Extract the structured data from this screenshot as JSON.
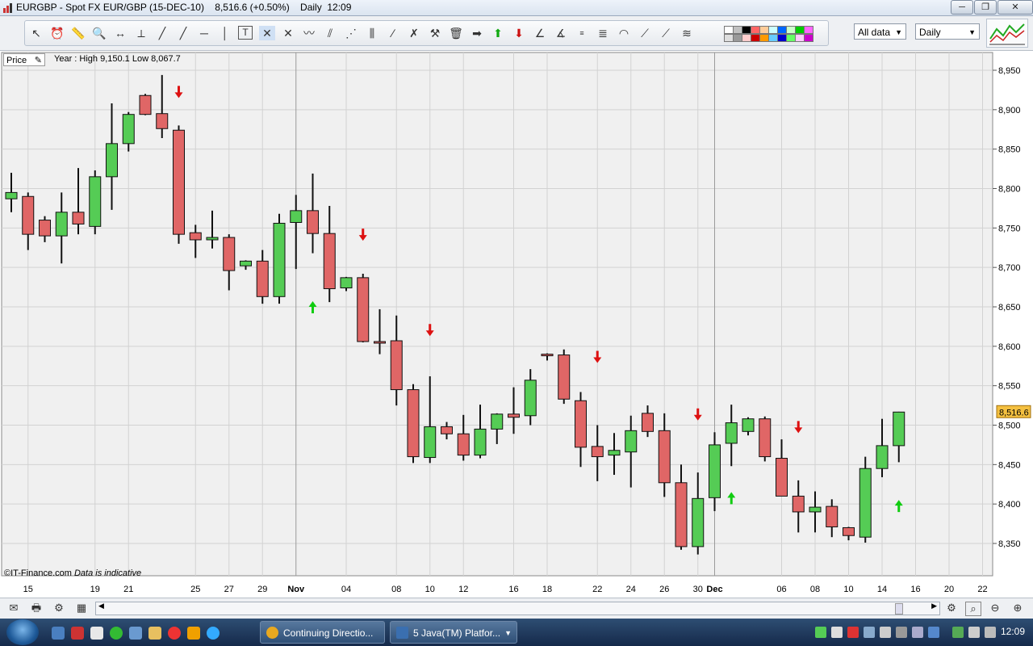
{
  "window": {
    "title": "EURGBP - Spot FX EUR/GBP (15-DEC-10)    8,516.6 (+0.50%)    Daily  12:09",
    "buttons": [
      "─",
      "❐",
      "✕"
    ]
  },
  "toolbar": {
    "tools": [
      "pointer",
      "alarm",
      "ruler",
      "zoom",
      "crosshair",
      "vline",
      "trendline",
      "ray",
      "hline",
      "vline2",
      "text",
      "select",
      "extend",
      "zigzag",
      "channel",
      "fan",
      "gann",
      "fib",
      "arrow-right",
      "arrow-up",
      "arrow-down",
      "label",
      "angle",
      "fib-ext",
      "fib-arc",
      "fib-time",
      "arc",
      "gann-fan",
      "elliott",
      "regression",
      "trash"
    ],
    "swatch_colors": [
      "#ffffff",
      "#dedede",
      "#c0c0c0",
      "#999999",
      "#000000",
      "#ffcccc",
      "#ff6666",
      "#cc0000",
      "#ffcc99",
      "#ff9900",
      "#ccffff",
      "#66ccff",
      "#0066ff",
      "#0000cc",
      "#ccffcc",
      "#66ff66",
      "#00cc00",
      "#ffccff",
      "#ff66ff",
      "#cc00cc"
    ],
    "range_select": "All data",
    "period_select": "Daily"
  },
  "chart_header": {
    "price_button": "Price",
    "range_info": "Year : High 9,150.1 Low 8,067.7"
  },
  "chart_footer": {
    "credit": "©IT-Finance.com",
    "credit_note": "Data is indicative"
  },
  "bottom_bar": {
    "icons": [
      "envelope-icon",
      "print-icon",
      "settings-icon",
      "sheet-icon"
    ]
  },
  "taskbar": {
    "tasks": [
      {
        "label": "Continuing Directio...",
        "icon_color": "#e8a820"
      },
      {
        "label": "5 Java(TM) Platfor...",
        "icon_color": "#3a6fb0"
      }
    ],
    "clock": "12:09"
  },
  "chart_data": {
    "type": "candlestick",
    "y_ticks": [
      "8,950",
      "8,900",
      "8,850",
      "8,800",
      "8,750",
      "8,700",
      "8,650",
      "8,600",
      "8,550",
      "8,500",
      "8,450",
      "8,400",
      "8,350"
    ],
    "ylim": [
      8310,
      8960
    ],
    "x_ticks": [
      "15",
      "19",
      "21",
      "25",
      "27",
      "29",
      "Nov",
      "04",
      "08",
      "10",
      "12",
      "16",
      "18",
      "22",
      "24",
      "26",
      "30",
      "Dec",
      "06",
      "08",
      "10",
      "14",
      "16",
      "20",
      "22"
    ],
    "bold_x_ticks": [
      "Nov",
      "Dec"
    ],
    "current_price_label": "8,516.6",
    "current_price": 8516.6,
    "up_color": "#55cc55",
    "down_color": "#e06666",
    "candles": [
      {
        "o": 8787,
        "h": 8820,
        "l": 8770,
        "c": 8795
      },
      {
        "o": 8790,
        "h": 8795,
        "l": 8722,
        "c": 8742
      },
      {
        "o": 8760,
        "h": 8765,
        "l": 8732,
        "c": 8740
      },
      {
        "o": 8740,
        "h": 8795,
        "l": 8705,
        "c": 8770
      },
      {
        "o": 8770,
        "h": 8826,
        "l": 8742,
        "c": 8755
      },
      {
        "o": 8752,
        "h": 8823,
        "l": 8742,
        "c": 8815
      },
      {
        "o": 8815,
        "h": 8908,
        "l": 8773,
        "c": 8857
      },
      {
        "o": 8857,
        "h": 8897,
        "l": 8847,
        "c": 8894
      },
      {
        "o": 8918,
        "h": 8920,
        "l": 8893,
        "c": 8894
      },
      {
        "o": 8895,
        "h": 8944,
        "l": 8864,
        "c": 8876
      },
      {
        "o": 8874,
        "h": 8880,
        "l": 8730,
        "c": 8742
      },
      {
        "o": 8744,
        "h": 8754,
        "l": 8712,
        "c": 8735
      },
      {
        "o": 8735,
        "h": 8772,
        "l": 8724,
        "c": 8738
      },
      {
        "o": 8738,
        "h": 8742,
        "l": 8671,
        "c": 8696
      },
      {
        "o": 8702,
        "h": 8709,
        "l": 8697,
        "c": 8708
      },
      {
        "o": 8708,
        "h": 8722,
        "l": 8654,
        "c": 8663
      },
      {
        "o": 8663,
        "h": 8768,
        "l": 8654,
        "c": 8756
      },
      {
        "o": 8757,
        "h": 8792,
        "l": 8698,
        "c": 8772
      },
      {
        "o": 8772,
        "h": 8819,
        "l": 8718,
        "c": 8743
      },
      {
        "o": 8743,
        "h": 8778,
        "l": 8656,
        "c": 8673
      },
      {
        "o": 8674,
        "h": 8688,
        "l": 8670,
        "c": 8687
      },
      {
        "o": 8687,
        "h": 8692,
        "l": 8605,
        "c": 8606
      },
      {
        "o": 8606,
        "h": 8647,
        "l": 8590,
        "c": 8605
      },
      {
        "o": 8607,
        "h": 8639,
        "l": 8525,
        "c": 8545
      },
      {
        "o": 8545,
        "h": 8552,
        "l": 8452,
        "c": 8460
      },
      {
        "o": 8459,
        "h": 8562,
        "l": 8452,
        "c": 8498
      },
      {
        "o": 8498,
        "h": 8504,
        "l": 8482,
        "c": 8489
      },
      {
        "o": 8489,
        "h": 8513,
        "l": 8455,
        "c": 8462
      },
      {
        "o": 8462,
        "h": 8526,
        "l": 8458,
        "c": 8495
      },
      {
        "o": 8495,
        "h": 8515,
        "l": 8476,
        "c": 8514
      },
      {
        "o": 8514,
        "h": 8548,
        "l": 8489,
        "c": 8510
      },
      {
        "o": 8512,
        "h": 8571,
        "l": 8500,
        "c": 8557
      },
      {
        "o": 8590,
        "h": 8591,
        "l": 8582,
        "c": 8589
      },
      {
        "o": 8589,
        "h": 8596,
        "l": 8527,
        "c": 8533
      },
      {
        "o": 8531,
        "h": 8542,
        "l": 8447,
        "c": 8472
      },
      {
        "o": 8473,
        "h": 8500,
        "l": 8429,
        "c": 8460
      },
      {
        "o": 8462,
        "h": 8490,
        "l": 8437,
        "c": 8468
      },
      {
        "o": 8466,
        "h": 8512,
        "l": 8421,
        "c": 8493
      },
      {
        "o": 8515,
        "h": 8525,
        "l": 8485,
        "c": 8492
      },
      {
        "o": 8493,
        "h": 8515,
        "l": 8409,
        "c": 8427
      },
      {
        "o": 8427,
        "h": 8450,
        "l": 8342,
        "c": 8346
      },
      {
        "o": 8346,
        "h": 8440,
        "l": 8336,
        "c": 8407
      },
      {
        "o": 8408,
        "h": 8491,
        "l": 8391,
        "c": 8475
      },
      {
        "o": 8477,
        "h": 8526,
        "l": 8448,
        "c": 8503
      },
      {
        "o": 8492,
        "h": 8510,
        "l": 8487,
        "c": 8508
      },
      {
        "o": 8508,
        "h": 8511,
        "l": 8454,
        "c": 8460
      },
      {
        "o": 8458,
        "h": 8482,
        "l": 8410,
        "c": 8410
      },
      {
        "o": 8410,
        "h": 8430,
        "l": 8364,
        "c": 8390
      },
      {
        "o": 8390,
        "h": 8416,
        "l": 8364,
        "c": 8396
      },
      {
        "o": 8397,
        "h": 8406,
        "l": 8358,
        "c": 8371
      },
      {
        "o": 8370,
        "h": 8371,
        "l": 8354,
        "c": 8360
      },
      {
        "o": 8358,
        "h": 8460,
        "l": 8351,
        "c": 8445
      },
      {
        "o": 8445,
        "h": 8508,
        "l": 8434,
        "c": 8474
      },
      {
        "o": 8474,
        "h": 8517,
        "l": 8453,
        "c": 8516.6
      }
    ],
    "signals": [
      {
        "i": 10,
        "dir": "down",
        "price": 8922
      },
      {
        "i": 18,
        "dir": "up",
        "price": 8650
      },
      {
        "i": 21,
        "dir": "down",
        "price": 8741
      },
      {
        "i": 25,
        "dir": "down",
        "price": 8620
      },
      {
        "i": 35,
        "dir": "down",
        "price": 8586
      },
      {
        "i": 41,
        "dir": "down",
        "price": 8513
      },
      {
        "i": 43,
        "dir": "up",
        "price": 8408
      },
      {
        "i": 47,
        "dir": "down",
        "price": 8497
      },
      {
        "i": 53,
        "dir": "up",
        "price": 8398
      }
    ]
  }
}
